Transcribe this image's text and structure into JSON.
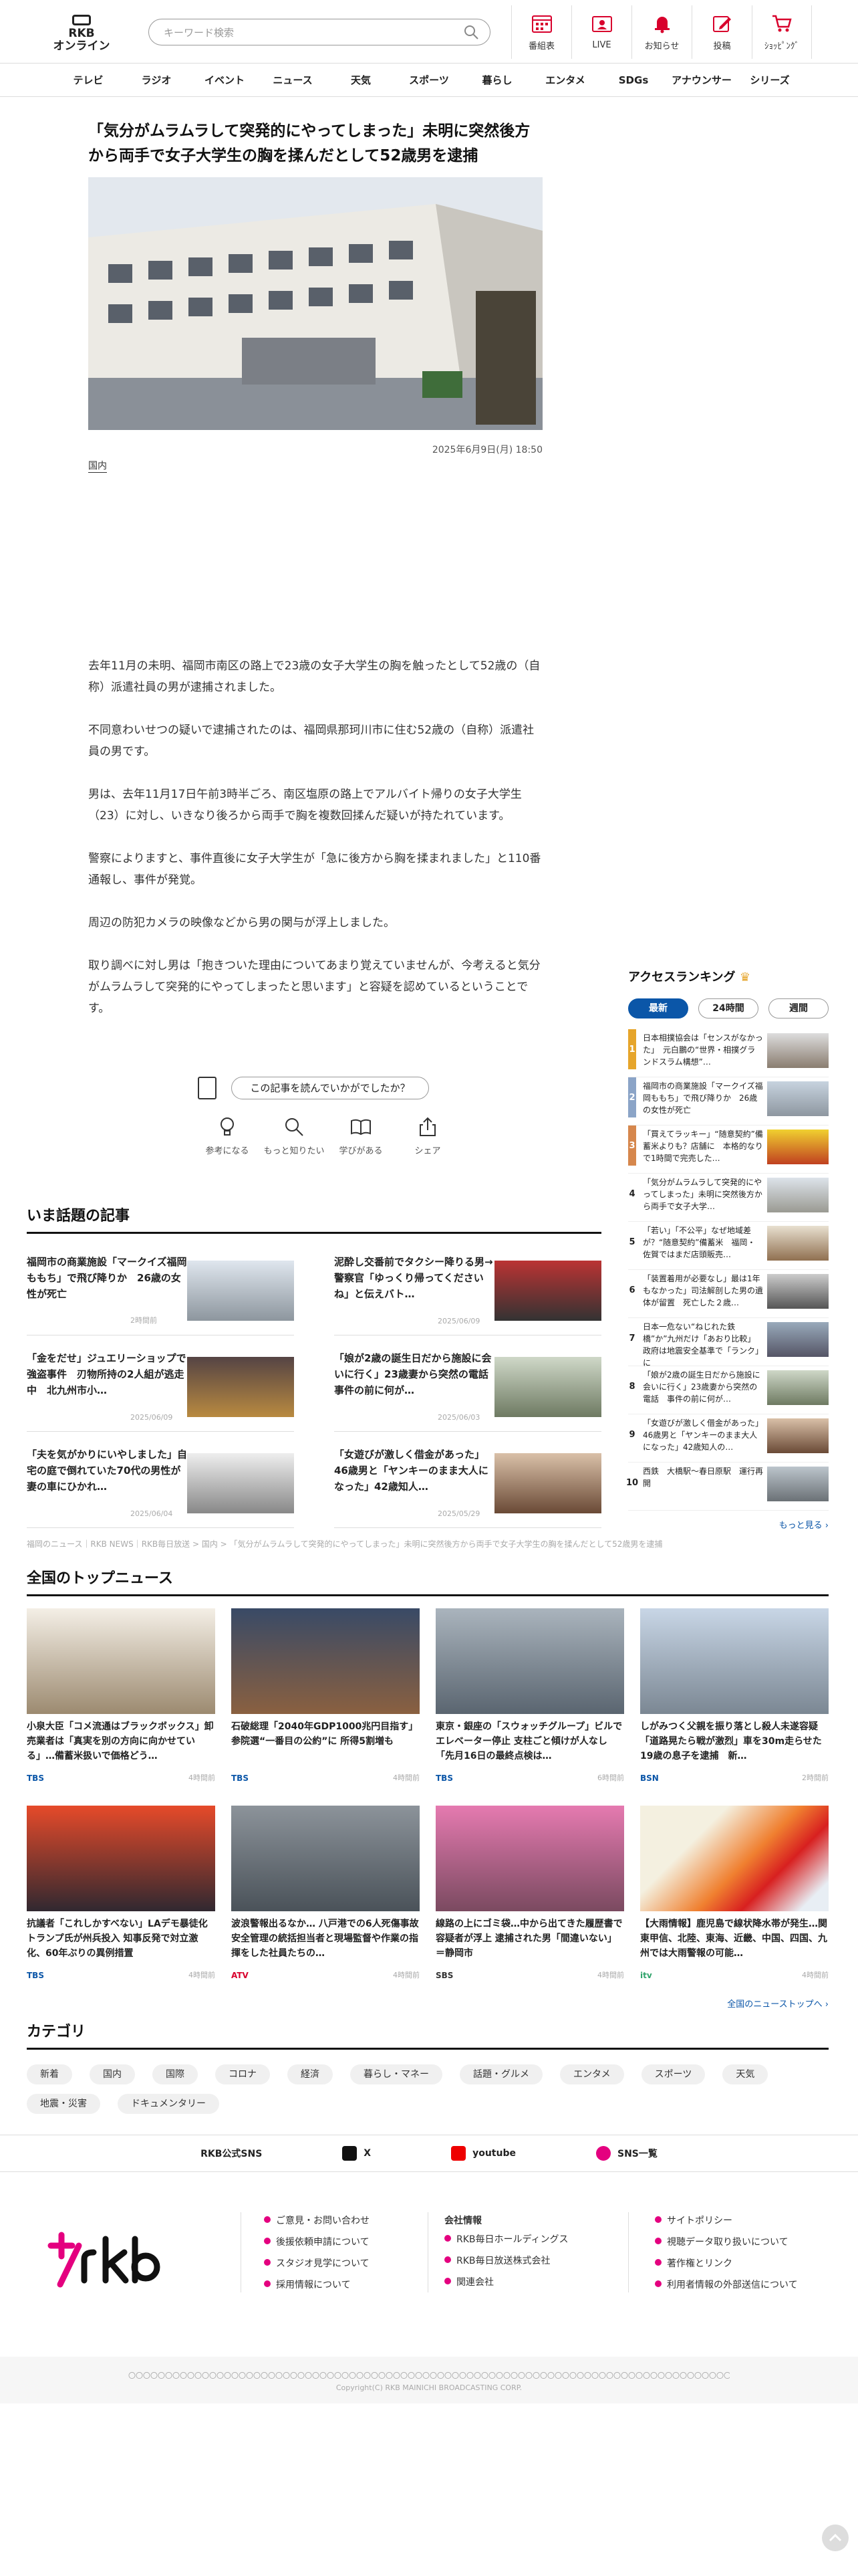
{
  "header": {
    "logo_text": "RKB\nオンライン",
    "search_placeholder": "キーワード検索",
    "nav": [
      "番組表",
      "LIVE",
      "お知らせ",
      "投稿",
      "ｼｮｯﾋﾟﾝｸﾞ"
    ]
  },
  "gnav": [
    "テレビ",
    "ラジオ",
    "イベント",
    "ニュース",
    "天気",
    "スポーツ",
    "暮らし",
    "エンタメ",
    "SDGs",
    "アナウンサー",
    "シリーズ"
  ],
  "article": {
    "title": "「気分がムラムラして突発的にやってしまった」未明に突然後方から両手で女子大学生の胸を揉んだとして52歳男を逮捕",
    "date": "2025年6月9日(月) 18:50",
    "tag": "国内",
    "paragraphs": [
      "去年11月の未明、福岡市南区の路上で23歳の女子大学生の胸を触ったとして52歳の（自称）派遣社員の男が逮捕されました。",
      "不同意わいせつの疑いで逮捕されたのは、福岡県那珂川市に住む52歳の（自称）派遣社員の男です。",
      "男は、去年11月17日午前3時半ごろ、南区塩原の路上でアルバイト帰りの女子大学生（23）に対し、いきなり後ろから両手で胸を複数回揉んだ疑いが持たれています。",
      "警察によりますと、事件直後に女子大学生が「急に後方から胸を揉まれました」と110番通報し、事件が発覚。",
      "周辺の防犯カメラの映像などから男の関与が浮上しました。",
      "取り調べに対し男は「抱きついた理由についてあまり覚えていませんが、今考えると気分がムラムラして突発的にやってしまったと思います」と容疑を認めているということです。"
    ],
    "feedback": "この記事を読んでいかがでしたか？",
    "reactions": [
      "参考になる",
      "もっと知りたい",
      "学びがある",
      "シェア"
    ]
  },
  "trending": {
    "title": "いま話題の記事",
    "items": [
      {
        "title": "福岡市の商業施設「マークイズ福岡ももち」で飛び降りか　26歳の女性が死亡",
        "date": "2時間前"
      },
      {
        "title": "泥酔し交番前でタクシー降りる男→警察官「ゆっくり帰ってくださいね」と伝えバト…",
        "date": "2025/06/09"
      },
      {
        "title": "「金をだせ」ジュエリーショップで強盗事件　刃物所持の2人組が逃走中　北九州市小…",
        "date": "2025/06/09"
      },
      {
        "title": "「娘が2歳の誕生日だから施設に会いに行く」23歳妻から突然の電話　事件の前に何が…",
        "date": "2025/06/03"
      },
      {
        "title": "「夫を気がかりにいやしました」自宅の庭で倒れていた70代の男性が妻の車にひかれ…",
        "date": "2025/06/04"
      },
      {
        "title": "「女遊びが激しく借金があった」46歳男と「ヤンキーのまま大人になった」42歳知人…",
        "date": "2025/05/29"
      }
    ]
  },
  "ranking": {
    "title": "アクセスランキング",
    "tabs": [
      "最新",
      "24時間",
      "週間"
    ],
    "items": [
      "日本相撲協会は「センスがなかった」　元白鵬の“世界・相撲グランドスラム構想”…",
      "福岡市の商業施設「マークイズ福岡ももち」で飛び降りか　26歳の女性が死亡",
      "「買えてラッキー」“随意契約”備蓄米よりも？店舗に　本格的なりで1時間で完売した…",
      "「気分がムラムラして突発的にやってしまった」未明に突然後方から両手で女子大学…",
      "「若い」「不公平」なぜ地域差が？“随意契約”備蓄米　福岡・佐賀ではまだ店頭販売…",
      "「装置着用が必要なし」最は1年もなかった」司法解剖した男の遺体が留置　死亡した２歳…",
      "日本一危ない“ねじれた鉄橋”か”九州だけ「あおり比較」政府は地震安全基準で「ランク」に",
      "「娘が2歳の誕生日だから施設に会いに行く」23歳妻から突然の電話　事件の前に何が…",
      "「女遊びが激しく借金があった」46歳男と「ヤンキーのまま大人になった」42歳知人の…",
      "西鉄　大橋駅〜春日原駅　運行再開"
    ],
    "more": "もっと見る"
  },
  "breadcrumb": "福岡のニュース｜RKB NEWS｜RKB毎日放送 > 国内 > 「気分がムラムラして突発的にやってしまった」未明に突然後方から両手で女子大学生の胸を揉んだとして52歳男を逮捕",
  "national": {
    "title": "全国のトップニュース",
    "items": [
      {
        "title": "小泉大臣「コメ流通はブラックボックス」卸売業者は「真実を別の方向に向かせている」…備蓄米扱いで価格どう…",
        "src": "TBS",
        "date": "4時間前",
        "src_color": "#0b56a8"
      },
      {
        "title": "石破総理「2040年GDP1000兆円目指す」参院選“一番目の公約”に 所得5割増も",
        "src": "TBS",
        "date": "4時間前",
        "src_color": "#0b56a8"
      },
      {
        "title": "東京・銀座の「スウォッチグループ」ビルでエレベーター停止 支柱ごと傾けが人なし「先月16日の最終点検は…",
        "src": "TBS",
        "date": "6時間前",
        "src_color": "#0b56a8"
      },
      {
        "title": "しがみつく父親を振り落とし殺人未遂容疑「道路晃たら戦が激烈」車を30m走らせた19歳の息子を逮捕　新…",
        "src": "BSN",
        "date": "2時間前",
        "src_color": "#0b56a8"
      },
      {
        "title": "抗議者「これしかすべない」LAデモ暴徒化 トランプ氏が州兵投入 知事反発で対立激化、60年ぶりの異例措置",
        "src": "TBS",
        "date": "4時間前",
        "src_color": "#0b56a8"
      },
      {
        "title": "波浪警報出るなか… 八戸港での6人死傷事故　安全管理の統括担当者と現場監督や作業の指揮をした社員たちの…",
        "src": "ATV",
        "date": "4時間前",
        "src_color": "#d8002c"
      },
      {
        "title": "線路の上にゴミ袋…中から出てきた履歴書で容疑者が浮上 逮捕された男「間違いない」＝静岡市",
        "src": "SBS",
        "date": "4時間前",
        "src_color": "#333333"
      },
      {
        "title": "【大雨情報】鹿児島で線状降水帯が発生…関東甲信、北陸、東海、近畿、中国、四国、九州では大雨警報の可能…",
        "src": "itv",
        "date": "4時間前",
        "src_color": "#30a36b"
      }
    ],
    "more": "全国のニューストップへ"
  },
  "category": {
    "title": "カテゴリ",
    "chips": [
      "新着",
      "国内",
      "国際",
      "コロナ",
      "経済",
      "暮らし・マネー",
      "話題・グルメ",
      "エンタメ",
      "スポーツ",
      "天気",
      "地震・災害",
      "ドキュメンタリー"
    ]
  },
  "sns": {
    "label": "RKB公式SNS",
    "x": "X",
    "youtube": "youtube",
    "list": "SNS一覧"
  },
  "footer": {
    "col1": [
      "ご意見・お問い合わせ",
      "後援依頼申請について",
      "スタジオ見学について",
      "採用情報について"
    ],
    "col2_head": "会社情報",
    "col2": [
      "RKB毎日ホールディングス",
      "RKB毎日放送株式会社",
      "関連会社"
    ],
    "col3": [
      "サイトポリシー",
      "視聴データ取り扱いについて",
      "著作権とリンク",
      "利用者情報の外部送信について"
    ],
    "notice": "〇〇〇〇〇〇〇〇〇〇〇〇〇〇〇〇〇〇〇〇〇〇〇〇〇〇〇〇〇〇〇〇〇〇〇〇〇〇〇〇〇〇〇〇〇〇〇〇〇〇〇〇〇〇〇〇〇〇〇〇〇〇〇〇〇〇〇〇〇〇〇〇〇〇〇〇〇〇〇〇〇〇〇〇〇〇〇〇〇〇〇〇〇〇〇〇〇〇〇〇〇〇〇〇〇〇〇〇〇〇〇〇〇〇〇〇〇〇〇〇〇〇〇〇〇〇〇〇〇〇〇〇〇〇〇〇〇〇〇〇〇〇〇〇〇〇〇〇",
    "copyright": "Copyright(C) RKB MAINICHI BROADCASTING CORP."
  }
}
